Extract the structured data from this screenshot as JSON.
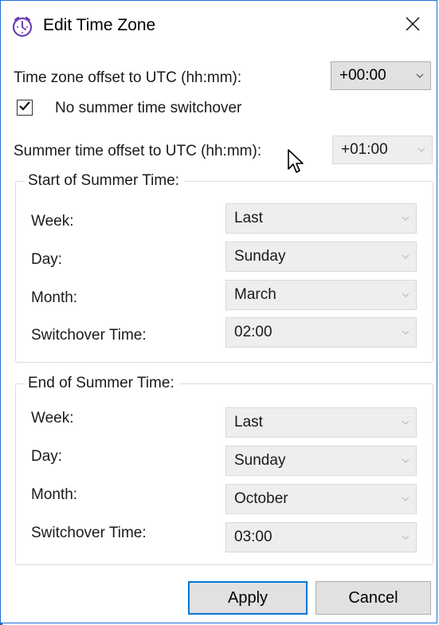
{
  "window": {
    "title": "Edit Time Zone",
    "icon": "clock-icon",
    "close_icon": "close-icon"
  },
  "offset": {
    "label": "Time zone offset to UTC (hh:mm):",
    "value": "+00:00"
  },
  "no_summer": {
    "label": "No summer time switchover",
    "checked": true
  },
  "summer_offset": {
    "label": "Summer time offset to UTC (hh:mm):",
    "value": "+01:00"
  },
  "start": {
    "legend": "Start of Summer Time:",
    "rows": [
      {
        "label": "Week:",
        "value": "Last"
      },
      {
        "label": "Day:",
        "value": "Sunday"
      },
      {
        "label": "Month:",
        "value": "March"
      },
      {
        "label": "Switchover Time:",
        "value": "02:00"
      }
    ]
  },
  "end": {
    "legend": "End of Summer Time:",
    "rows": [
      {
        "label": "Week:",
        "value": "Last"
      },
      {
        "label": "Day:",
        "value": "Sunday"
      },
      {
        "label": "Month:",
        "value": "October"
      },
      {
        "label": "Switchover Time:",
        "value": "03:00"
      }
    ]
  },
  "buttons": {
    "apply": "Apply",
    "cancel": "Cancel"
  },
  "colors": {
    "accent": "#0078d7",
    "icon_purple": "#6b3fb0",
    "window_border": "#1e6fd9"
  }
}
